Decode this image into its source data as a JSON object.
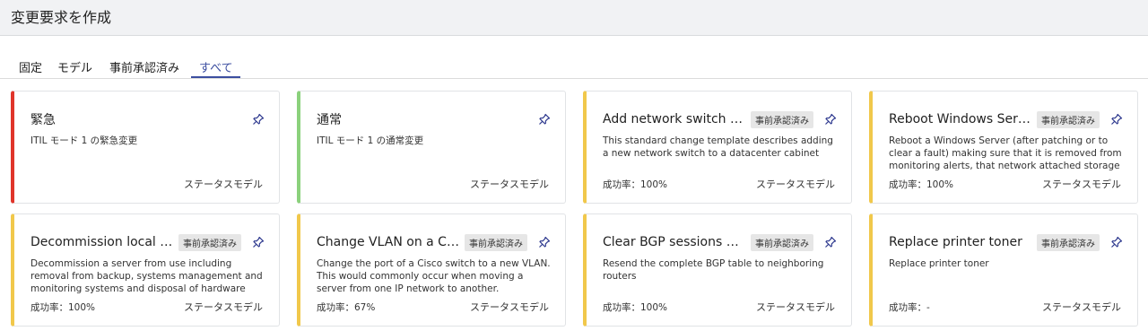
{
  "header": {
    "title": "変更要求を作成"
  },
  "tabs": [
    {
      "label": "固定"
    },
    {
      "label": "モデル"
    },
    {
      "label": "事前承認済み"
    },
    {
      "label": "すべて",
      "active": true
    }
  ],
  "colors": {
    "emergency": "#e0352b",
    "normal": "#8bd17c",
    "standard": "#f1c84b",
    "accent": "#3c4ea0"
  },
  "cards": [
    {
      "title": "緊急",
      "badge": "",
      "description": "ITIL モード 1 の緊急変更",
      "success_rate": "",
      "model": "ステータスモデル",
      "pin_icon": "pin-icon"
    },
    {
      "title": "通常",
      "badge": "",
      "description": "ITIL モード 1 の通常変更",
      "success_rate": "",
      "model": "ステータスモデル",
      "pin_icon": "pin-icon"
    },
    {
      "title": "Add network switch to …",
      "badge": "事前承認済み",
      "description": "This standard change template describes adding a new network switch to a datacenter cabinet",
      "success_rate": "成功率：100%",
      "model": "ステータスモデル",
      "pin_icon": "pin-icon"
    },
    {
      "title": "Reboot Windows Server",
      "badge": "事前承認済み",
      "description": "Reboot a Windows Server (after patching or to clear a fault) making sure that it is removed from monitoring alerts, that network attached storage is...",
      "success_rate": "成功率：100%",
      "model": "ステータスモデル",
      "pin_icon": "pin-icon"
    },
    {
      "title": "Decommission local of…",
      "badge": "事前承認済み",
      "description": "Decommission a server from use including removal from backup, systems management and monitoring systems and disposal of hardware",
      "success_rate": "成功率：100%",
      "model": "ステータスモデル",
      "pin_icon": "pin-icon"
    },
    {
      "title": "Change VLAN on a Cis…",
      "badge": "事前承認済み",
      "description": "Change the port of a Cisco switch to a new VLAN. This would commonly occur when moving a server from one IP network to another.",
      "success_rate": "成功率：67%",
      "model": "ステータスモデル",
      "pin_icon": "pin-icon"
    },
    {
      "title": "Clear BGP sessions on …",
      "badge": "事前承認済み",
      "description": "Resend the complete BGP table to neighboring routers",
      "success_rate": "成功率：100%",
      "model": "ステータスモデル",
      "pin_icon": "pin-icon"
    },
    {
      "title": "Replace printer toner",
      "badge": "事前承認済み",
      "description": "Replace printer toner",
      "success_rate": "成功率：-",
      "model": "ステータスモデル",
      "pin_icon": "pin-icon"
    }
  ]
}
